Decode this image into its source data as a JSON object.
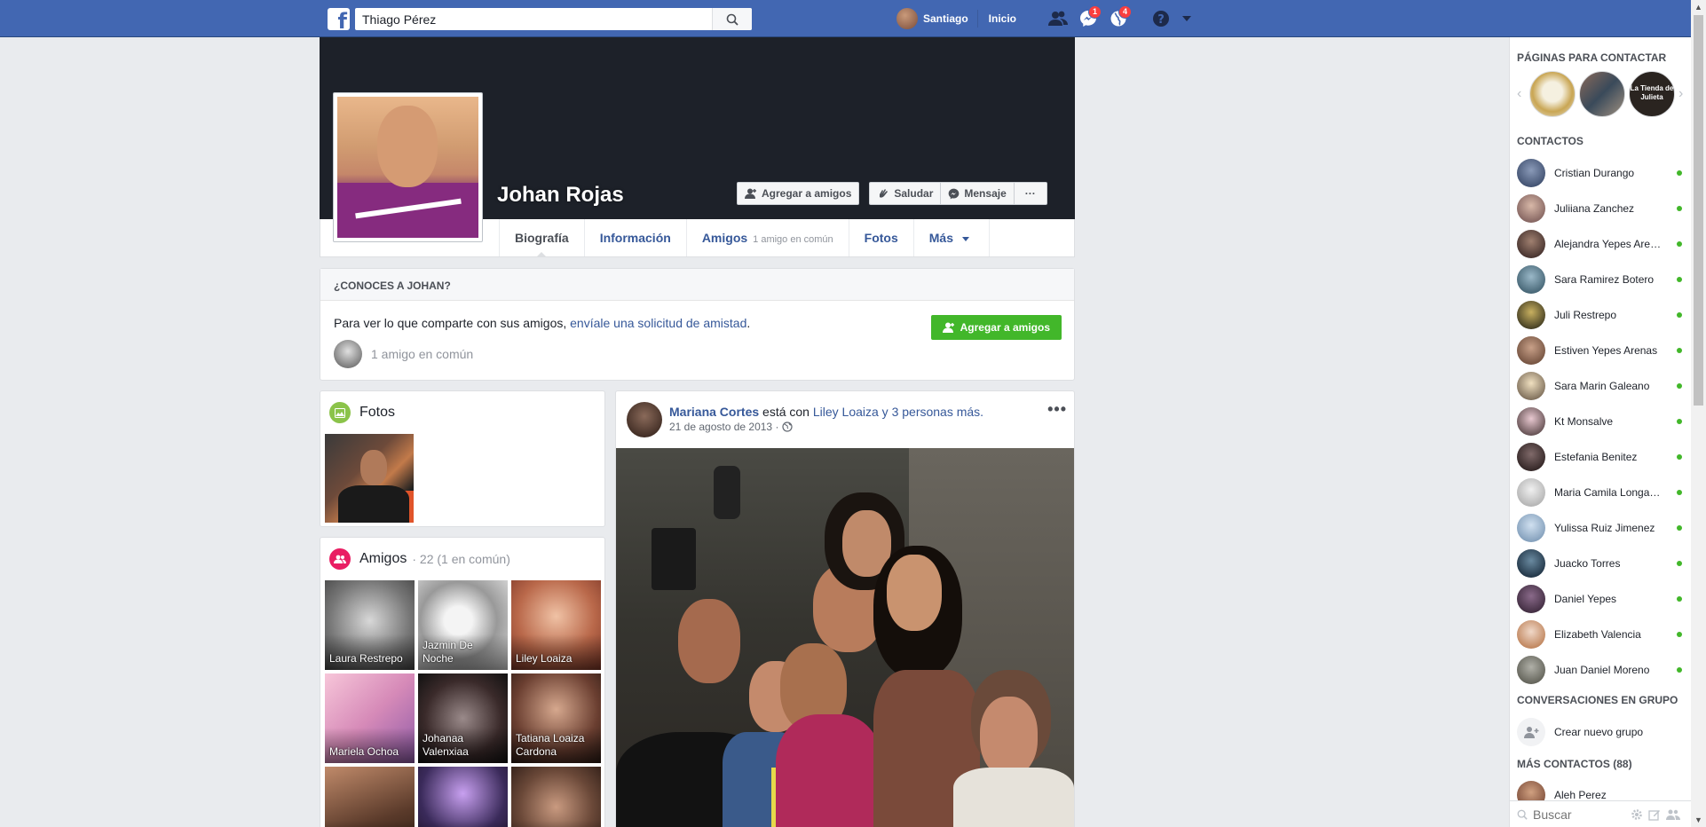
{
  "topbar": {
    "search_value": "Thiago Pérez",
    "user_name": "Santiago",
    "home_label": "Inicio",
    "messages_badge": "1",
    "notifications_badge": "4",
    "brand_color": "#4267b2"
  },
  "profile": {
    "name": "Johan Rojas",
    "add_friend_label": "Agregar a amigos",
    "poke_label": "Saludar",
    "message_label": "Mensaje",
    "more_dots": "···"
  },
  "tabs": [
    {
      "label": "Biografía",
      "active": true
    },
    {
      "label": "Información"
    },
    {
      "label": "Amigos",
      "sub": "1 amigo en común"
    },
    {
      "label": "Fotos"
    },
    {
      "label": "Más"
    }
  ],
  "know": {
    "header": "¿Conoces a Johan?",
    "text_prefix": "Para ver lo que comparte con sus amigos, ",
    "text_link": "envíale una solicitud de amistad",
    "text_suffix": ".",
    "mutual": "1 amigo en común",
    "button_label": "Agregar a amigos"
  },
  "photos": {
    "title": "Fotos"
  },
  "friends": {
    "title": "Amigos",
    "meta": "· 22 (1 en común)",
    "tiles": [
      {
        "name": "Laura Restrepo"
      },
      {
        "name": "Jazmin De Noche"
      },
      {
        "name": "Liley Loaiza"
      },
      {
        "name": "Mariela Ochoa"
      },
      {
        "name": "Johanaa Valenxiaa"
      },
      {
        "name": "Tatiana Loaiza Cardona"
      },
      {
        "name": ""
      },
      {
        "name": ""
      },
      {
        "name": ""
      }
    ]
  },
  "post": {
    "author": "Mariana Cortes",
    "with_text": " está con ",
    "with_link": "Liley Loaiza y 3 personas más.",
    "date": "21 de agosto de 2013 ·",
    "menu": "•••"
  },
  "sidebar": {
    "pages_header": "Páginas para contactar",
    "pages_tile_text": "La Tienda de Julieta",
    "contacts_header": "Contactos",
    "contacts": [
      "Cristian Durango",
      "Juliiana Zanchez",
      "Alejandra Yepes Arenas",
      "Sara Ramirez Botero",
      "Juli Restrepo",
      "Estiven Yepes Arenas",
      "Sara Marin Galeano",
      "Kt Monsalve",
      "Estefania Benitez",
      "Maria Camila Longas Ochoa",
      "Yulissa Ruiz Jimenez",
      "Juacko Torres",
      "Daniel Yepes",
      "Elizabeth Valencia",
      "Juan Daniel Moreno"
    ],
    "groups_header": "Conversaciones en grupo",
    "new_group": "Crear nuevo grupo",
    "more_contacts_header": "Más contactos (88)",
    "more_contacts": [
      "Aleh Perez"
    ],
    "search_placeholder": "Buscar",
    "online_color": "#42b72a"
  }
}
